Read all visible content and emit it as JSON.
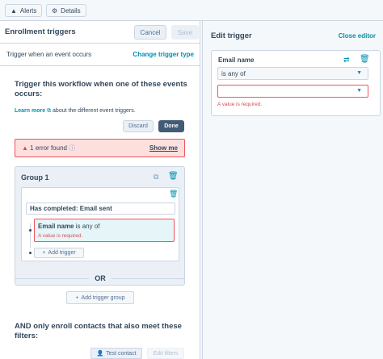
{
  "topbar": {
    "alerts_label": "Alerts",
    "details_label": "Details"
  },
  "left": {
    "title": "Enrollment triggers",
    "cancel_label": "Cancel",
    "save_label": "Save",
    "trigger_type_text": "Trigger when an event occurs",
    "change_trigger_type": "Change trigger type",
    "heading_line1": "Trigger this workflow when one of these events",
    "heading_line2": "occurs:",
    "learn_more": "Learn more",
    "learn_more_rest": "about the different event triggers.",
    "discard_label": "Discard",
    "done_label": "Done",
    "error_count_text": "1 error found",
    "show_me": "Show me",
    "group_title": "Group 1",
    "has_completed": "Has completed: Email sent",
    "filter_property": "Email name",
    "filter_operator": "is any of",
    "filter_error": "A value is required.",
    "add_trigger": "Add trigger",
    "or_text": "OR",
    "add_trigger_group": "Add trigger group",
    "and_line1": "AND only enroll contacts that also meet these",
    "and_line2": "filters:",
    "test_contact": "Test contact",
    "edit_filters": "Edit filters"
  },
  "right": {
    "title": "Edit trigger",
    "close_editor": "Close editor",
    "property_label": "Email name",
    "operator_value": "is any of",
    "value_placeholder": "",
    "error_text": "A value is required."
  },
  "colors": {
    "accent": "#0091ae",
    "error": "#f2545b",
    "dark_button": "#425b76"
  }
}
